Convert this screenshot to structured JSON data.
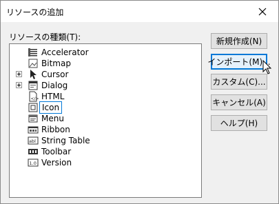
{
  "window": {
    "title": "リソースの追加"
  },
  "tree": {
    "label": "リソースの種類(T):",
    "items": [
      {
        "label": "Accelerator",
        "icon": "accelerator-icon",
        "expandable": false
      },
      {
        "label": "Bitmap",
        "icon": "bitmap-icon",
        "expandable": false
      },
      {
        "label": "Cursor",
        "icon": "cursor-icon",
        "expandable": true
      },
      {
        "label": "Dialog",
        "icon": "dialog-icon",
        "expandable": true
      },
      {
        "label": "HTML",
        "icon": "html-icon",
        "expandable": false
      },
      {
        "label": "Icon",
        "icon": "icon-resource-icon",
        "expandable": false,
        "selected": true
      },
      {
        "label": "Menu",
        "icon": "menu-icon",
        "expandable": false
      },
      {
        "label": "Ribbon",
        "icon": "ribbon-icon",
        "expandable": false
      },
      {
        "label": "String Table",
        "icon": "string-table-icon",
        "expandable": false
      },
      {
        "label": "Toolbar",
        "icon": "toolbar-icon",
        "expandable": false
      },
      {
        "label": "Version",
        "icon": "version-icon",
        "expandable": false
      }
    ]
  },
  "buttons": {
    "new": "新規作成(N)",
    "import": "インポート(M)...",
    "custom": "カスタム(C)...",
    "cancel": "キャンセル(A)",
    "help": "ヘルプ(H)"
  },
  "colors": {
    "focus_border": "#0078d7",
    "button_face": "#e1e1e1",
    "dialog_face": "#f0f0f0"
  }
}
